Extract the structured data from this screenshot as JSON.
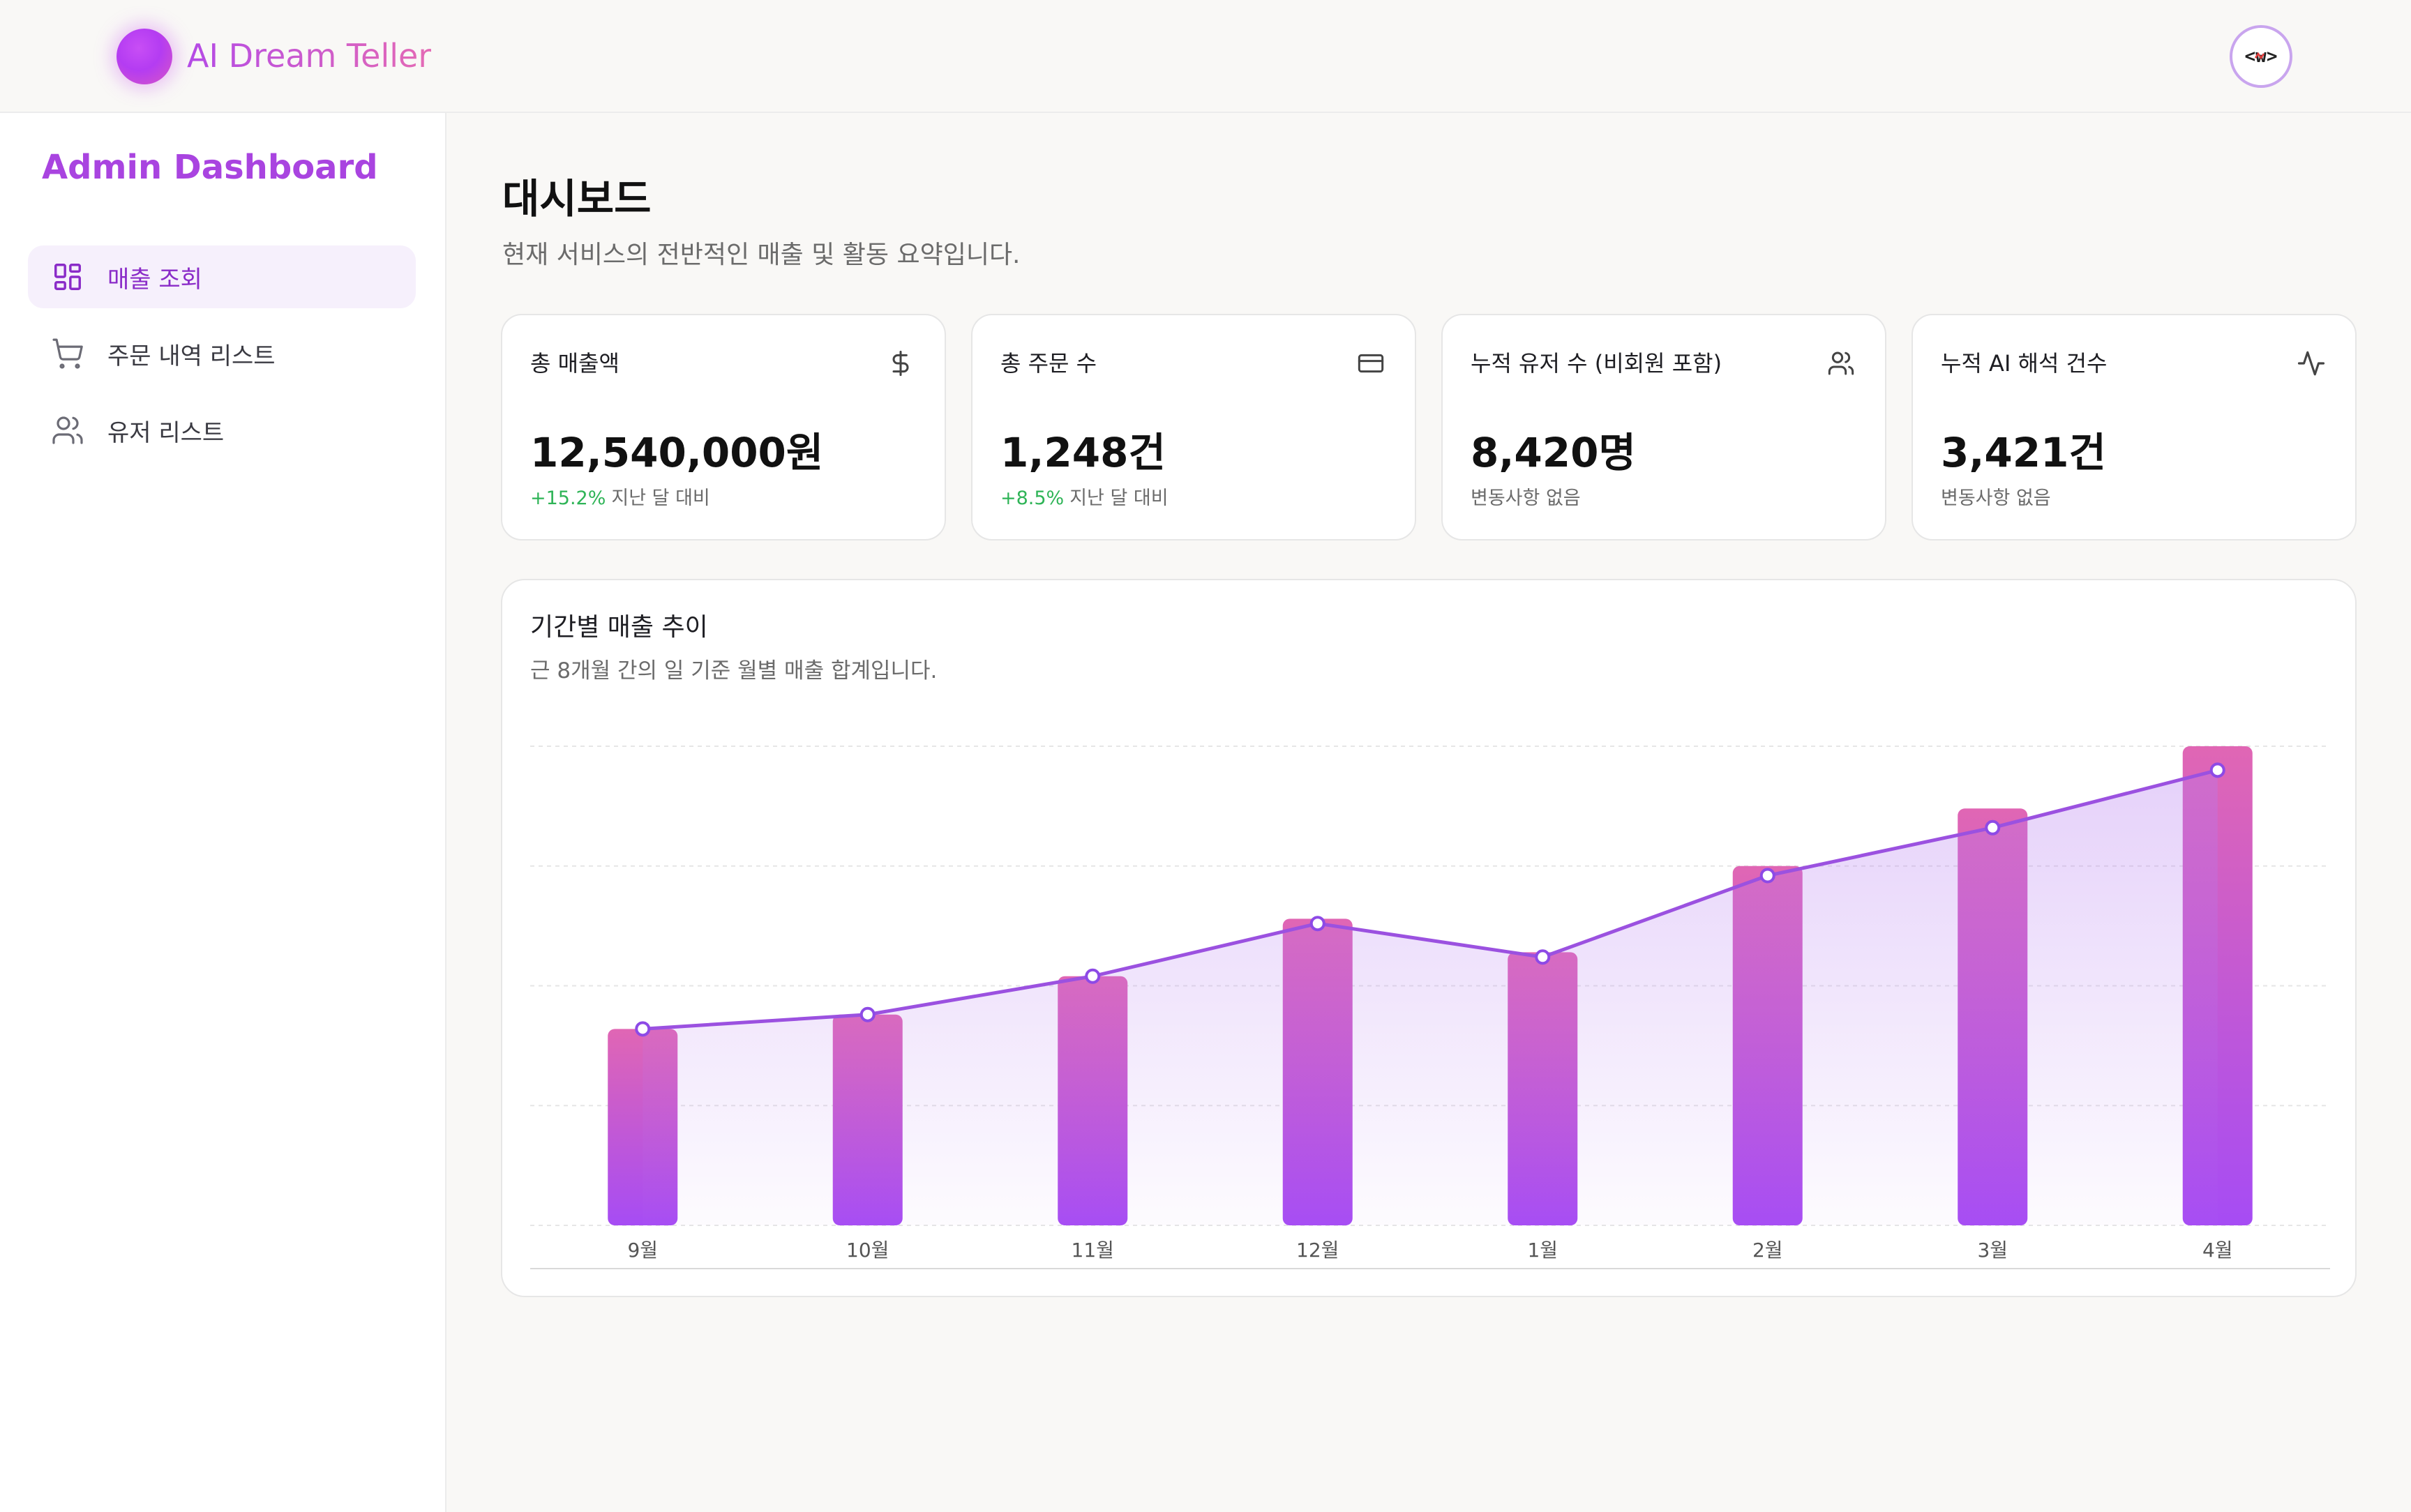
{
  "header": {
    "app_title": "AI Dream Teller",
    "avatar_text": "<w>",
    "brand_gradient": [
      "#b44be6",
      "#e46ab5"
    ]
  },
  "sidebar": {
    "title": "Admin Dashboard",
    "items": [
      {
        "label": "매출 조회",
        "icon": "grid-icon",
        "active": true
      },
      {
        "label": "주문 내역 리스트",
        "icon": "cart-icon",
        "active": false
      },
      {
        "label": "유저 리스트",
        "icon": "users-icon",
        "active": false
      }
    ]
  },
  "main": {
    "title": "대시보드",
    "subtitle": "현재 서비스의 전반적인 매출 및 활동 요약입니다.",
    "cards": [
      {
        "label": "총 매출액",
        "icon": "dollar-icon",
        "value": "12,540,000원",
        "change": "+15.2%",
        "note": "지난 달 대비"
      },
      {
        "label": "총 주문 수",
        "icon": "credit-card-icon",
        "value": "1,248건",
        "change": "+8.5%",
        "note": "지난 달 대비"
      },
      {
        "label": "누적 유저 수 (비회원 포함)",
        "icon": "users-icon",
        "value": "8,420명",
        "change": "",
        "note": "변동사항 없음"
      },
      {
        "label": "누적 AI 해석 건수",
        "icon": "activity-icon",
        "value": "3,421건",
        "change": "",
        "note": "변동사항 없음"
      }
    ],
    "chart": {
      "title": "기간별 매출 추이",
      "subtitle": "근 8개월 간의 일 기준 월별 매출 합계입니다."
    }
  },
  "colors": {
    "accent": "#a944e0",
    "positive": "#2fb457",
    "bar_top": "#e066b4",
    "bar_bottom": "#a64cf4",
    "line": "#9b51e0"
  },
  "chart_data": {
    "type": "bar",
    "categories": [
      "9월",
      "10월",
      "11월",
      "12월",
      "1월",
      "2월",
      "3월",
      "4월"
    ],
    "series": [
      {
        "type": "bar",
        "values": [
          41,
          44,
          52,
          64,
          57,
          75,
          87,
          100
        ]
      },
      {
        "type": "line",
        "values": [
          41,
          44,
          52,
          63,
          56,
          73,
          83,
          95
        ]
      }
    ],
    "ylim": [
      0,
      100
    ],
    "grid": true,
    "xlabel": "",
    "ylabel": ""
  }
}
